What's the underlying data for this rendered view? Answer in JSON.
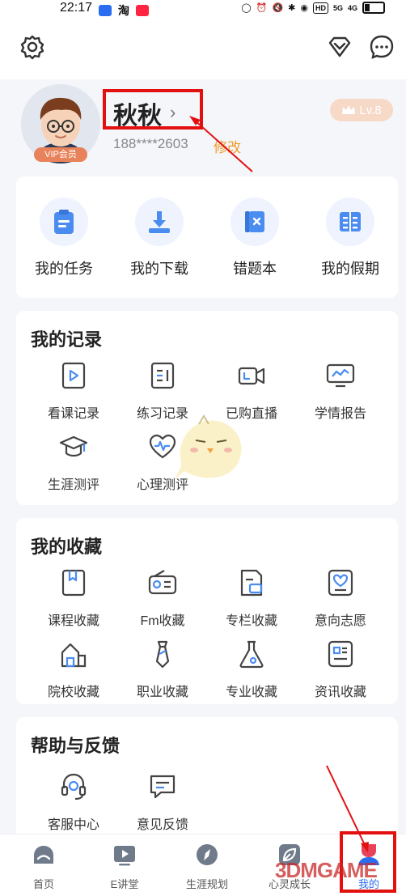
{
  "status_bar": {
    "time": "22:17",
    "app_icons": [
      "tiktok-icon",
      "taobao-icon",
      "xiaohongshu-icon"
    ],
    "taobao_label": "淘",
    "hd_label": "HD",
    "signal1": "5G",
    "signal2": "4G"
  },
  "profile": {
    "name": "秋秋",
    "phone": "188****2603",
    "edit_label": "修改",
    "vip_badge": "VIP会员",
    "level": "Lv.8"
  },
  "quick_actions": [
    {
      "label": "我的任务",
      "icon": "clipboard-icon"
    },
    {
      "label": "我的下载",
      "icon": "download-icon"
    },
    {
      "label": "错题本",
      "icon": "wrong-book-icon"
    },
    {
      "label": "我的假期",
      "icon": "holiday-book-icon"
    }
  ],
  "records": {
    "title": "我的记录",
    "items": [
      {
        "label": "看课记录",
        "icon": "play-record-icon"
      },
      {
        "label": "练习记录",
        "icon": "practice-record-icon"
      },
      {
        "label": "已购直播",
        "icon": "live-video-icon"
      },
      {
        "label": "学情报告",
        "icon": "report-monitor-icon"
      },
      {
        "label": "生涯测评",
        "icon": "graduation-cap-icon"
      },
      {
        "label": "心理测评",
        "icon": "heart-pulse-icon"
      }
    ]
  },
  "favorites": {
    "title": "我的收藏",
    "items": [
      {
        "label": "课程收藏",
        "icon": "course-bookmark-icon"
      },
      {
        "label": "Fm收藏",
        "icon": "radio-icon"
      },
      {
        "label": "专栏收藏",
        "icon": "column-doc-icon"
      },
      {
        "label": "意向志愿",
        "icon": "heart-card-icon"
      },
      {
        "label": "院校收藏",
        "icon": "school-building-icon"
      },
      {
        "label": "职业收藏",
        "icon": "tie-icon"
      },
      {
        "label": "专业收藏",
        "icon": "flask-icon"
      },
      {
        "label": "资讯收藏",
        "icon": "news-icon"
      }
    ]
  },
  "help": {
    "title": "帮助与反馈",
    "items": [
      {
        "label": "客服中心",
        "icon": "headset-icon"
      },
      {
        "label": "意见反馈",
        "icon": "feedback-chat-icon"
      }
    ]
  },
  "tabs": [
    {
      "label": "首页",
      "icon": "home-icon"
    },
    {
      "label": "E讲堂",
      "icon": "video-play-icon"
    },
    {
      "label": "生涯规划",
      "icon": "compass-icon"
    },
    {
      "label": "心灵成长",
      "icon": "leaf-icon"
    },
    {
      "label": "我的",
      "icon": "user-icon",
      "active": true
    }
  ],
  "watermark": "3DMGAME",
  "colors": {
    "accent_blue": "#4a8cf0",
    "edit_orange": "#f09a2a",
    "vip_orange": "#e8825a",
    "annotation_red": "#e31010"
  }
}
